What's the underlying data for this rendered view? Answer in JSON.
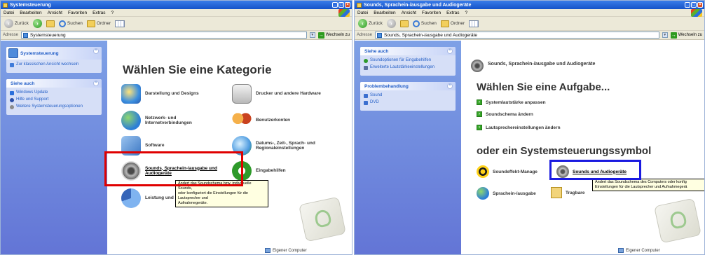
{
  "left": {
    "title": "Systemsteuerung",
    "menu": [
      "Datei",
      "Bearbeiten",
      "Ansicht",
      "Favoriten",
      "Extras",
      "?"
    ],
    "toolbar": {
      "back": "Zurück",
      "search": "Suchen",
      "folders": "Ordner"
    },
    "address": {
      "label": "Adresse",
      "value": "Systemsteuerung",
      "go": "Wechseln zu"
    },
    "sidebar": {
      "panel1_title": "Systemsteuerung",
      "panel1_link": "Zur klassischen Ansicht wechseln",
      "panel2_title": "Siehe auch",
      "panel2_links": [
        "Windows Update",
        "Hilfe und Support",
        "Weitere Systemsteuerungsoptionen"
      ]
    },
    "heading": "Wählen Sie eine Kategorie",
    "categories": [
      "Darstellung und Designs",
      "Drucker und andere Hardware",
      "Netzwerk- und\nInternetverbindungen",
      "Benutzerkonten",
      "Software",
      "Datums-, Zeit-, Sprach- und\nRegionaleinstellungen",
      "Sounds, Sprachein-/ausgabe und\nAudiogeräte",
      "Eingabehilfen",
      "Leistung und"
    ],
    "tooltip": "Ändert das Soundschema bzw. individuelle Sounds,\noder konfiguriert die Einstellungen für die Lautsprecher und\nAufnahmegeräte.",
    "my_computer": "Eigener Computer"
  },
  "right": {
    "title": "Sounds, Sprachein-/ausgabe und Audiogeräte",
    "menu": [
      "Datei",
      "Bearbeiten",
      "Ansicht",
      "Favoriten",
      "Extras",
      "?"
    ],
    "toolbar": {
      "back": "Zurück",
      "search": "Suchen",
      "folders": "Ordner"
    },
    "address": {
      "label": "Adresse",
      "value": "Sounds, Sprachein-/ausgabe und Audiogeräte",
      "go": "Wechseln zu"
    },
    "sidebar": {
      "panel1_title": "Siehe auch",
      "panel1_links": [
        "Soundoptionen für Eingabehilfen",
        "Erweiterte Lautstärkeeinstellungen"
      ],
      "panel2_title": "Problembehandlung",
      "panel2_links": [
        "Sound",
        "DVD"
      ]
    },
    "category_header": "Sounds, Sprachein-/ausgabe und Audiogeräte",
    "heading_task": "Wählen Sie eine Aufgabe...",
    "tasks": [
      "Systemlautstärke anpassen",
      "Soundschema ändern",
      "Lautsprechereinstellungen ändern"
    ],
    "heading_or": "oder ein Systemsteuerungssymbol",
    "icons": [
      "Soundeffekt-Manage",
      "Sounds und Audiogeräte",
      "Sprachein-/ausgabe",
      "Tragbare"
    ],
    "tooltip": "Ändert das Soundschema des Computers oder konfig\nEinstellungen für die Lautsprecher und Aufnahmegerä",
    "my_computer": "Eigener Computer"
  },
  "colors": {
    "title_bar": "#1553c9",
    "sidebar": "#6375d6",
    "highlight_red": "#e00000",
    "highlight_blue": "#1a1ae0",
    "link": "#215dc6"
  }
}
